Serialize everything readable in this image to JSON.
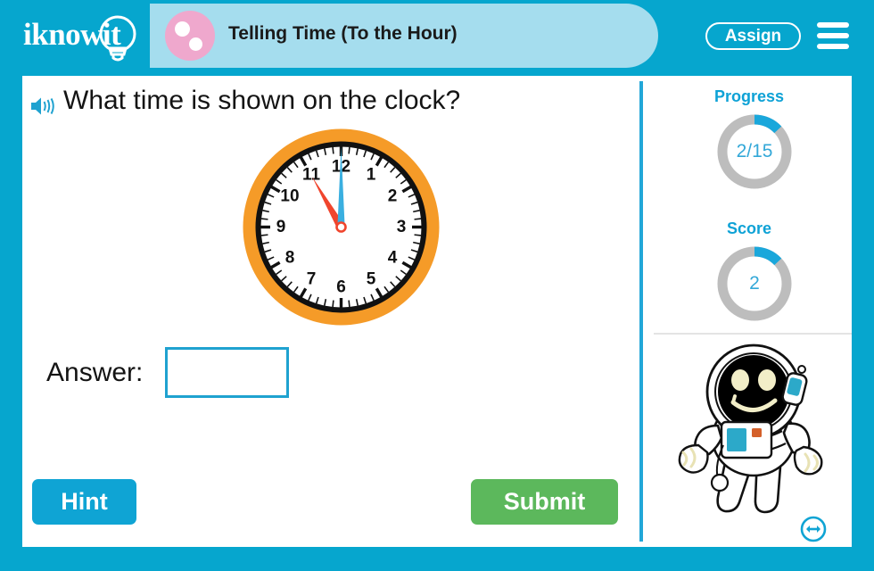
{
  "header": {
    "logo_text": "iknowit",
    "logo_icon": "lightbulb-icon",
    "title": "Telling Time (To the Hour)",
    "badge_icon": "pink-dots-badge",
    "assign_label": "Assign",
    "menu_icon": "hamburger-menu-icon",
    "bar_color": "#06A6CE",
    "title_pill_color": "#A5DDEE",
    "badge_color": "#EFA8CD"
  },
  "question": {
    "audio_icon": "speaker-icon",
    "text": "What time is shown on the clock?"
  },
  "clock": {
    "time_shown": "11:00",
    "hour_hand_points_to": 11,
    "minute_hand_points_to": 12,
    "numbers": [
      "12",
      "1",
      "2",
      "3",
      "4",
      "5",
      "6",
      "7",
      "8",
      "9",
      "10",
      "11"
    ],
    "bezel_color": "#F59B28",
    "face_color": "#FFFFFF",
    "hour_hand_color": "#F0452D",
    "minute_hand_color": "#3AAFE0",
    "center_color": "#F0452D"
  },
  "answer": {
    "label": "Answer:",
    "value": "",
    "placeholder": "",
    "border_color": "#1FA2D0"
  },
  "actions": {
    "hint_label": "Hint",
    "hint_color": "#0FA4D4",
    "submit_label": "Submit",
    "submit_color": "#5CB85C"
  },
  "side_panel": {
    "progress": {
      "label": "Progress",
      "value": "2/15",
      "current": 2,
      "total": 15,
      "percent": 13,
      "arc_color": "#1AA7DB",
      "track_color": "#BDBDBD"
    },
    "score": {
      "label": "Score",
      "value": "2",
      "percent": 13,
      "arc_color": "#1AA7DB",
      "track_color": "#BDBDBD"
    },
    "mascot_icon": "astronaut-mascot",
    "mascot_colors": {
      "visor": "#000000",
      "face_features": "#F2EEC8",
      "panel": "#2CA9C9",
      "suit": "#FFFFFF"
    }
  },
  "footer": {
    "resize_icon": "resize-horizontal-icon",
    "resize_color": "#0FA4D4"
  }
}
